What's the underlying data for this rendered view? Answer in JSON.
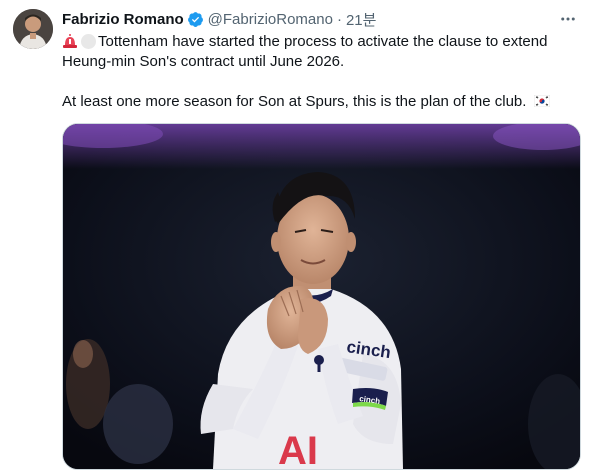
{
  "tweet": {
    "author_name": "Fabrizio Romano",
    "handle": "@FabrizioRomano",
    "separator": "·",
    "time": "21분",
    "line1_text": "Tottenham have started the process to activate the clause to extend",
    "line2_text": "Heung-min Son's contract until June 2026.",
    "line3_text": "At least one more season for Son at Spurs, this is the plan of the club.",
    "emojis": [
      "siren-emoji",
      "white-circle-emoji",
      "south-korea-flag-emoji"
    ]
  },
  "media": {
    "shirt_sponsor_text": "cinch",
    "armband_text": "cinch"
  },
  "colors": {
    "text": "#0f1419",
    "secondary": "#536471",
    "verified": "#1d9bf0",
    "border": "#cfd9de"
  },
  "icons": {
    "verified": "verified-badge-icon",
    "more": "more-options-icon"
  }
}
